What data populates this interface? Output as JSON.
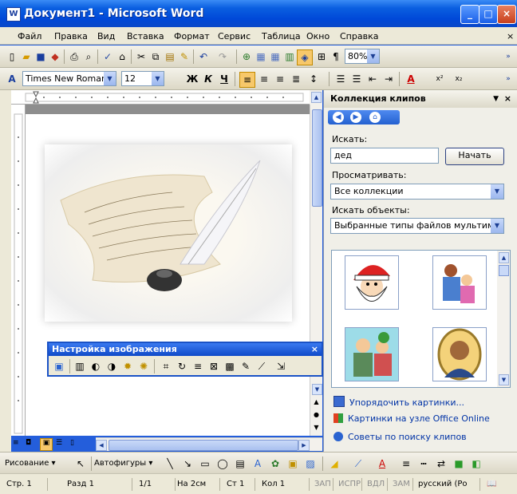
{
  "window": {
    "title": "Документ1 - Microsoft Word",
    "icon": "word-doc-icon"
  },
  "menu": [
    "Файл",
    "Правка",
    "Вид",
    "Вставка",
    "Формат",
    "Сервис",
    "Таблица",
    "Окно",
    "Справка"
  ],
  "menu_close": "×",
  "formatting": {
    "font_name": "Times New Roman",
    "font_size": "12",
    "zoom": "80%",
    "bold": "Ж",
    "italic": "К",
    "underline": "Ч"
  },
  "picture_toolbar": {
    "title": "Настройка изображения",
    "close": "×"
  },
  "taskpane": {
    "title": "Коллекция клипов",
    "search_label": "Искать:",
    "search_value": "дед",
    "go_button": "Начать",
    "browse_label": "Просматривать:",
    "browse_value": "Все коллекции",
    "types_label": "Искать объекты:",
    "types_value": "Выбранные типы файлов мультимеди",
    "links": [
      "Упорядочить картинки...",
      "Картинки на узле Office Online",
      "Советы по поиску клипов"
    ]
  },
  "drawing": {
    "draw_label": "Рисование",
    "autoshapes_label": "Автофигуры"
  },
  "status": {
    "page": "Стр. 1",
    "section": "Разд 1",
    "pages": "1/1",
    "position": "На 2см",
    "line": "Ст 1",
    "column": "Кол 1",
    "rec": "ЗАП",
    "trk": "ИСПР",
    "ext": "ВДЛ",
    "ovr": "ЗАМ",
    "language": "русский (Ро"
  },
  "colors": {
    "title_blue": "#0a5fe0",
    "chrome": "#ece9d8",
    "link": "#0033a6"
  }
}
